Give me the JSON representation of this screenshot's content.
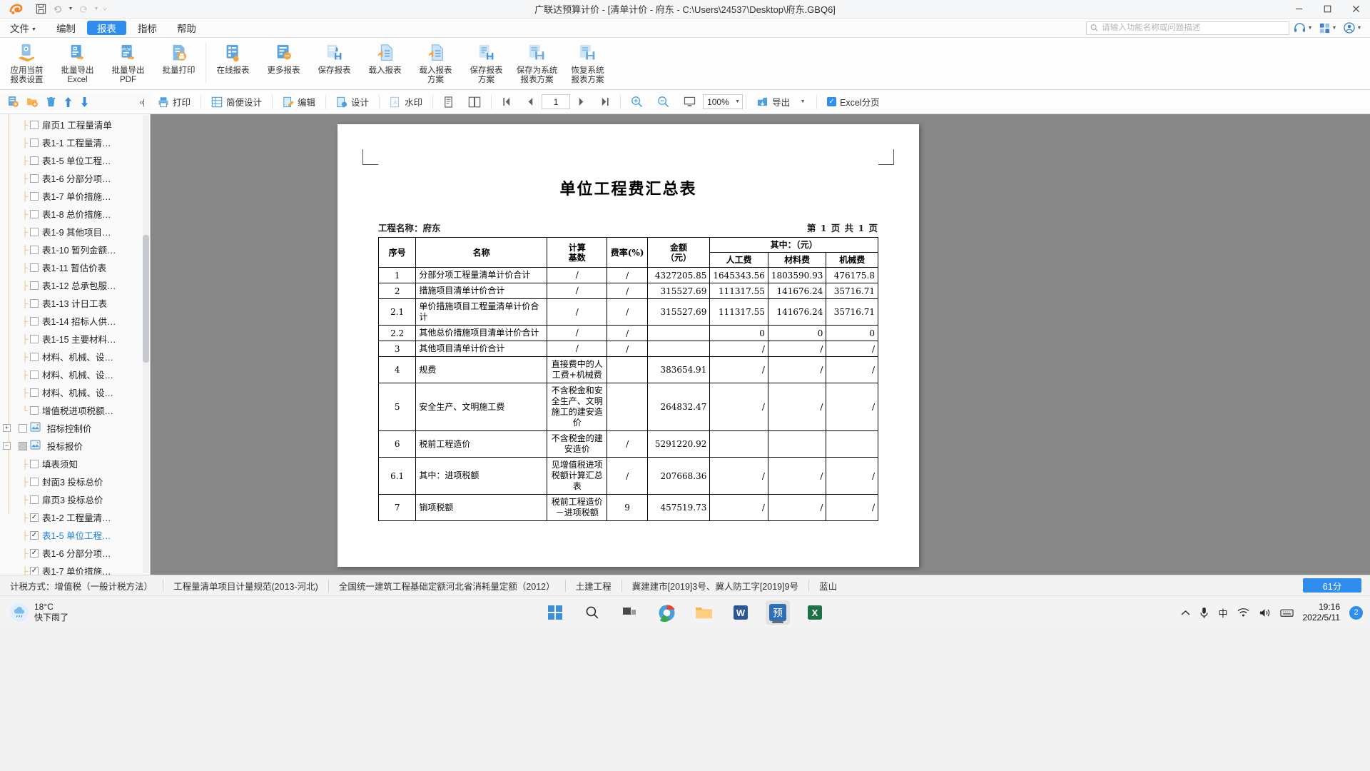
{
  "window": {
    "title": "广联达预算计价 - [清单计价 - 府东 - C:\\Users\\24537\\Desktop\\府东.GBQ6]",
    "minimize": "–",
    "maximize": "□",
    "close": "✕"
  },
  "quick_access": {
    "save_icon": "save-icon",
    "undo_icon": "undo-icon",
    "redo_icon": "redo-icon",
    "more_icon": "chevron-double-down-icon"
  },
  "menu": {
    "items": [
      {
        "label": "文件",
        "has_caret": true,
        "active": false
      },
      {
        "label": "编制",
        "has_caret": false,
        "active": false
      },
      {
        "label": "报表",
        "has_caret": false,
        "active": true
      },
      {
        "label": "指标",
        "has_caret": false,
        "active": false
      },
      {
        "label": "帮助",
        "has_caret": false,
        "active": false
      }
    ]
  },
  "search": {
    "placeholder": "请输入功能名称或问题描述",
    "value": ""
  },
  "ribbon": {
    "buttons": [
      {
        "label": "应用当前\n报表设置",
        "icon": "apply-settings-icon"
      },
      {
        "label": "批量导出\nExcel",
        "icon": "export-excel-icon"
      },
      {
        "label": "批量导出\nPDF",
        "icon": "export-pdf-icon"
      },
      {
        "label": "批量打印",
        "icon": "batch-print-icon"
      },
      {
        "label": "在线报表",
        "icon": "online-report-icon"
      },
      {
        "label": "更多报表",
        "icon": "more-report-icon"
      },
      {
        "label": "保存报表",
        "icon": "save-report-icon"
      },
      {
        "label": "载入报表",
        "icon": "load-report-icon"
      },
      {
        "label": "载入报表\n方案",
        "icon": "load-report-scheme-icon"
      },
      {
        "label": "保存报表\n方案",
        "icon": "save-report-scheme-icon"
      },
      {
        "label": "保存为系统\n报表方案",
        "icon": "save-system-scheme-icon"
      },
      {
        "label": "恢复系统\n报表方案",
        "icon": "restore-system-scheme-icon"
      }
    ]
  },
  "preview_toolbar": {
    "print": "打印",
    "simple_design": "简便设计",
    "edit": "编辑",
    "design": "设计",
    "watermark": "水印",
    "single_page_icon": "single-page-view-icon",
    "double_page_icon": "double-page-view-icon",
    "first_page_icon": "first-page-icon",
    "prev_page_icon": "prev-page-icon",
    "page_value": "1",
    "next_page_icon": "next-page-icon",
    "last_page_icon": "last-page-icon",
    "zoom_in_icon": "zoom-in-icon",
    "zoom_out_icon": "zoom-out-icon",
    "fit_page_icon": "fit-page-icon",
    "zoom_value": "100%",
    "export": "导出",
    "excel_pagination": "Excel分页",
    "excel_pagination_checked": true
  },
  "sidebar": {
    "tools": {
      "add_report_icon": "add-report-icon",
      "add_folder_icon": "add-folder-icon",
      "delete_icon": "trash-icon",
      "move_up_icon": "arrow-up-icon",
      "move_down_icon": "arrow-down-icon",
      "collapse_icon": "collapse-panel-icon"
    },
    "items": [
      {
        "label": "扉页1 工程量清单",
        "depth": 2,
        "type": "leaf",
        "checked": false
      },
      {
        "label": "表1-1 工程量清…",
        "depth": 2,
        "type": "leaf",
        "checked": false
      },
      {
        "label": "表1-5 单位工程…",
        "depth": 2,
        "type": "leaf",
        "checked": false
      },
      {
        "label": "表1-6 分部分项…",
        "depth": 2,
        "type": "leaf",
        "checked": false
      },
      {
        "label": "表1-7 单价措施…",
        "depth": 2,
        "type": "leaf",
        "checked": false
      },
      {
        "label": "表1-8 总价措施…",
        "depth": 2,
        "type": "leaf",
        "checked": false
      },
      {
        "label": "表1-9 其他项目…",
        "depth": 2,
        "type": "leaf",
        "checked": false
      },
      {
        "label": "表1-10 暂列金额…",
        "depth": 2,
        "type": "leaf",
        "checked": false
      },
      {
        "label": "表1-11 暂估价表",
        "depth": 2,
        "type": "leaf",
        "checked": false
      },
      {
        "label": "表1-12 总承包服…",
        "depth": 2,
        "type": "leaf",
        "checked": false
      },
      {
        "label": "表1-13 计日工表",
        "depth": 2,
        "type": "leaf",
        "checked": false
      },
      {
        "label": "表1-14 招标人供…",
        "depth": 2,
        "type": "leaf",
        "checked": false
      },
      {
        "label": "表1-15 主要材料…",
        "depth": 2,
        "type": "leaf",
        "checked": false
      },
      {
        "label": "材料、机械、设…",
        "depth": 2,
        "type": "leaf",
        "checked": false
      },
      {
        "label": "材料、机械、设…",
        "depth": 2,
        "type": "leaf",
        "checked": false
      },
      {
        "label": "材料、机械、设…",
        "depth": 2,
        "type": "leaf",
        "checked": false
      },
      {
        "label": "增值税进项税额…",
        "depth": 2,
        "type": "last-leaf",
        "checked": false
      },
      {
        "label": "招标控制价",
        "depth": 0,
        "type": "folder",
        "expander": "+",
        "checked": false
      },
      {
        "label": "投标报价",
        "depth": 0,
        "type": "folder",
        "expander": "−",
        "checked": "partial"
      },
      {
        "label": "填表须知",
        "depth": 2,
        "type": "leaf",
        "checked": false
      },
      {
        "label": "封面3 投标总价",
        "depth": 2,
        "type": "leaf",
        "checked": false
      },
      {
        "label": "扉页3 投标总价",
        "depth": 2,
        "type": "leaf",
        "checked": false
      },
      {
        "label": "表1-2 工程量清…",
        "depth": 2,
        "type": "leaf",
        "checked": true
      },
      {
        "label": "表1-5 单位工程…",
        "depth": 2,
        "type": "leaf",
        "checked": true,
        "selected": true
      },
      {
        "label": "表1-6 分部分项…",
        "depth": 2,
        "type": "leaf",
        "checked": true
      },
      {
        "label": "表1-7 单价措施…",
        "depth": 2,
        "type": "leaf",
        "checked": true
      }
    ]
  },
  "report": {
    "title": "单位工程费汇总表",
    "project_label": "工程名称：府东",
    "page_label": "第 1 页  共 1 页",
    "headers": {
      "seq": "序号",
      "name": "名称",
      "basis": "计算\n基数",
      "rate": "费率(%)",
      "amount": "金额\n（元）",
      "among_which": "其中：（元）",
      "labor": "人工费",
      "material": "材料费",
      "machinery": "机械费"
    },
    "rows": [
      {
        "seq": "1",
        "name": "分部分项工程量清单计价合计",
        "basis": "/",
        "rate": "/",
        "amount": "4327205.85",
        "labor": "1645343.56",
        "material": "1803590.93",
        "machinery": "476175.8"
      },
      {
        "seq": "2",
        "name": "措施项目清单计价合计",
        "basis": "/",
        "rate": "/",
        "amount": "315527.69",
        "labor": "111317.55",
        "material": "141676.24",
        "machinery": "35716.71"
      },
      {
        "seq": "2.1",
        "name": "单价措施项目工程量清单计价合计",
        "basis": "/",
        "rate": "/",
        "amount": "315527.69",
        "labor": "111317.55",
        "material": "141676.24",
        "machinery": "35716.71"
      },
      {
        "seq": "2.2",
        "name": "其他总价措施项目清单计价合计",
        "basis": "/",
        "rate": "/",
        "amount": "",
        "labor": "0",
        "material": "0",
        "machinery": "0"
      },
      {
        "seq": "3",
        "name": "其他项目清单计价合计",
        "basis": "/",
        "rate": "/",
        "amount": "",
        "labor": "/",
        "material": "/",
        "machinery": "/"
      },
      {
        "seq": "4",
        "name": "规费",
        "basis": "直接费中的人工费+机械费",
        "rate": "",
        "amount": "383654.91",
        "labor": "/",
        "material": "/",
        "machinery": "/"
      },
      {
        "seq": "5",
        "name": "安全生产、文明施工费",
        "basis": "不含税金和安全生产、文明施工的建安造价",
        "rate": "",
        "amount": "264832.47",
        "labor": "/",
        "material": "/",
        "machinery": "/"
      },
      {
        "seq": "6",
        "name": "税前工程造价",
        "basis": "不含税金的建安造价",
        "rate": "/",
        "amount": "5291220.92",
        "labor": "",
        "material": "",
        "machinery": ""
      },
      {
        "seq": "6.1",
        "name": "其中：进项税额",
        "basis": "见增值税进项税额计算汇总表",
        "rate": "/",
        "amount": "207668.36",
        "labor": "/",
        "material": "/",
        "machinery": "/"
      },
      {
        "seq": "7",
        "name": "销项税额",
        "basis": "税前工程造价－进项税额",
        "rate": "9",
        "amount": "457519.73",
        "labor": "/",
        "material": "/",
        "machinery": "/"
      }
    ]
  },
  "statusbar": {
    "cells": [
      "计税方式：增值税（一般计税方法）",
      "工程量清单项目计量规范(2013-河北)",
      "全国统一建筑工程基础定额河北省消耗量定额（2012）",
      "土建工程",
      "冀建建市[2019]3号、冀人防工字[2019]9号",
      "蓝山"
    ],
    "score": "61分"
  },
  "taskbar": {
    "weather": {
      "temp": "18°C",
      "desc": "快下雨了",
      "icon": "rain-cloud-icon"
    },
    "apps": [
      {
        "name": "start-button",
        "icon": "windows-logo-icon"
      },
      {
        "name": "search-button",
        "icon": "search-icon"
      },
      {
        "name": "task-view-button",
        "icon": "task-view-icon"
      },
      {
        "name": "browser-button",
        "icon": "browser-icon"
      },
      {
        "name": "file-explorer-button",
        "icon": "folder-icon"
      },
      {
        "name": "word-button",
        "icon": "word-icon",
        "label": "W"
      },
      {
        "name": "glodon-button",
        "icon": "glodon-app-icon",
        "label": "预",
        "active": true
      },
      {
        "name": "excel-button",
        "icon": "excel-icon",
        "label": "X"
      }
    ],
    "tray": {
      "chevron": "⌃",
      "mic_icon": "microphone-icon",
      "ime": "中",
      "wifi_icon": "wifi-icon",
      "volume_icon": "volume-icon",
      "keyboard_icon": "keyboard-icon",
      "time": "19:16",
      "date": "2022/5/11",
      "notif_count": "2"
    }
  },
  "colors": {
    "accent": "#2f8ded",
    "brand_orange": "#f28c28",
    "icon_blue": "#3c8fdc",
    "preview_bg": "#878787"
  }
}
